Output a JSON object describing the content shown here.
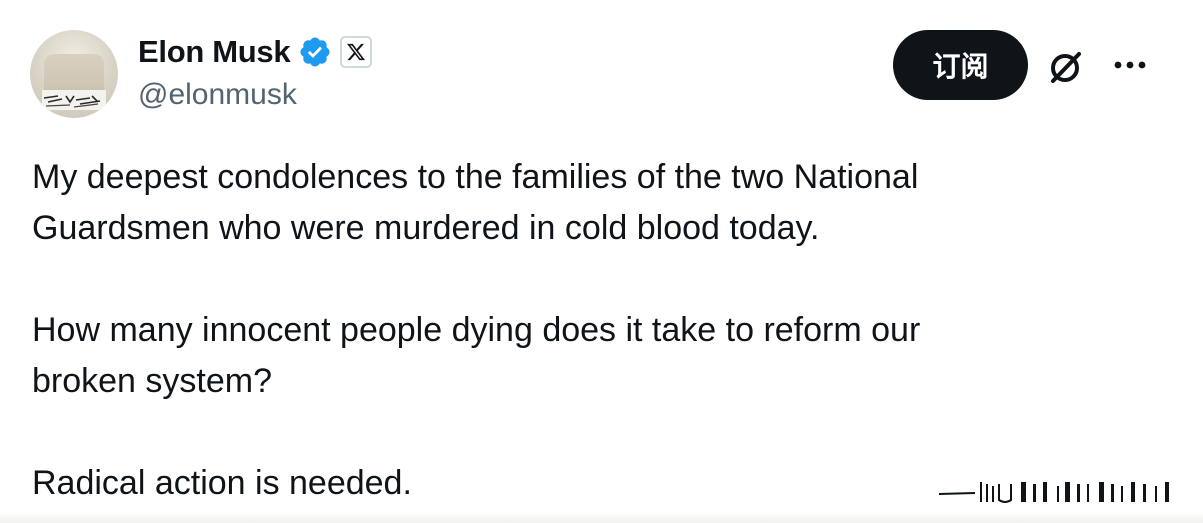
{
  "author": {
    "display_name": "Elon Musk",
    "handle": "@elonmusk",
    "verified_icon": "verified-badge-icon",
    "affiliation_icon": "x-logo-icon",
    "brand_blue": "#1d9bf0"
  },
  "actions": {
    "subscribe_label": "订阅",
    "grok_icon": "grok-icon",
    "more_icon": "more-horizontal-icon"
  },
  "tweet": {
    "paragraphs": [
      [
        "My deepest condolences to the families of the two National",
        "Guardsmen who were murdered in cold blood today."
      ],
      [
        "How many innocent people dying does it take to reform our",
        "broken system?"
      ],
      [
        "Radical action is needed."
      ]
    ]
  }
}
